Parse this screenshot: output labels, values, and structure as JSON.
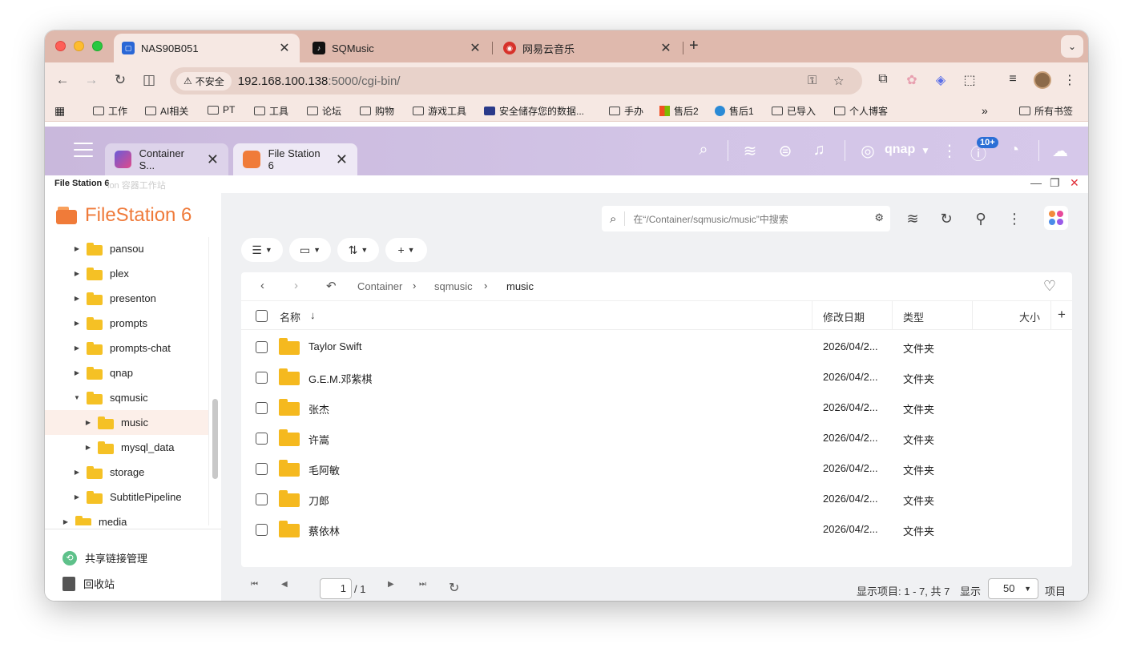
{
  "browser": {
    "tabs": [
      {
        "title": "NAS90B051",
        "close": "✕"
      },
      {
        "title": "SQMusic",
        "close": "✕"
      },
      {
        "title": "网易云音乐",
        "close": "✕"
      }
    ],
    "new_tab": "+",
    "tab_menu": "⌄",
    "insecure_label": "不安全",
    "url_host": "192.168.100.138",
    "url_path": ":5000/cgi-bin/"
  },
  "bookmarks": {
    "items": [
      "工作",
      "AI相关",
      "PT",
      "工具",
      "论坛",
      "购物",
      "游戏工具",
      "安全储存您的数据...",
      "手办",
      "售后2",
      "售后1",
      "已导入",
      "个人博客"
    ],
    "more": "»",
    "all": "所有书签"
  },
  "qts": {
    "app_tabs": [
      {
        "title": "Container S...",
        "close": "✕"
      },
      {
        "title": "File Station 6",
        "close": "✕"
      }
    ],
    "username": "qnap",
    "notif_badge": "10+"
  },
  "app": {
    "window_title": "File Station 6",
    "ghost_title": "ion 容器工作站",
    "brand": "FileStation 6"
  },
  "sidebar": {
    "tree": [
      {
        "label": "pansou",
        "expanded": false,
        "level": 1
      },
      {
        "label": "plex",
        "expanded": false,
        "level": 1
      },
      {
        "label": "presenton",
        "expanded": false,
        "level": 1
      },
      {
        "label": "prompts",
        "expanded": false,
        "level": 1
      },
      {
        "label": "prompts-chat",
        "expanded": false,
        "level": 1
      },
      {
        "label": "qnap",
        "expanded": false,
        "level": 1
      },
      {
        "label": "sqmusic",
        "expanded": true,
        "level": 1
      },
      {
        "label": "music",
        "expanded": false,
        "level": 2,
        "selected": true
      },
      {
        "label": "mysql_data",
        "expanded": false,
        "level": 2
      },
      {
        "label": "storage",
        "expanded": false,
        "level": 1
      },
      {
        "label": "SubtitlePipeline",
        "expanded": false,
        "level": 1
      },
      {
        "label": "media",
        "expanded": false,
        "level": 0
      }
    ],
    "share_links": "共享链接管理",
    "recycle_bin": "回收站"
  },
  "main": {
    "search_placeholder": "在“/Container/sqmusic/music”中搜索",
    "breadcrumb": [
      "Container",
      "sqmusic",
      "music"
    ],
    "columns": {
      "name": "名称",
      "modified": "修改日期",
      "type": "类型",
      "size": "大小"
    },
    "sort_icon": "↓",
    "add_column": "+",
    "rows": [
      {
        "name": "Taylor Swift",
        "date": "2026/04/2...",
        "type": "文件夹"
      },
      {
        "name": "G.E.M.邓紫棋",
        "date": "2026/04/2...",
        "type": "文件夹"
      },
      {
        "name": "张杰",
        "date": "2026/04/2...",
        "type": "文件夹"
      },
      {
        "name": "许嵩",
        "date": "2026/04/2...",
        "type": "文件夹"
      },
      {
        "name": "毛阿敏",
        "date": "2026/04/2...",
        "type": "文件夹"
      },
      {
        "name": "刀郎",
        "date": "2026/04/2...",
        "type": "文件夹"
      },
      {
        "name": "蔡依林",
        "date": "2026/04/2...",
        "type": "文件夹"
      }
    ]
  },
  "pager": {
    "current_page": "1",
    "total": "/ 1",
    "info": "显示项目: 1 - 7, 共 7",
    "show_label": "显示",
    "per_page": "50",
    "unit": "项目"
  }
}
